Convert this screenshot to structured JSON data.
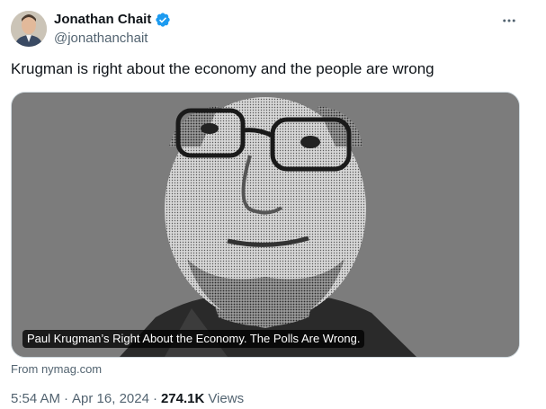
{
  "author": {
    "name": "Jonathan Chait",
    "handle": "@jonathanchait",
    "verified_color": "#1d9bf0"
  },
  "tweet": {
    "text": "Krugman is right about the economy and the people are wrong"
  },
  "card": {
    "caption": "Paul Krugman’s Right About the Economy. The Polls Are Wrong.",
    "source": "From nymag.com"
  },
  "meta": {
    "time": "5:54 AM",
    "date": "Apr 16, 2024",
    "views_count": "274.1K",
    "views_label": "Views"
  }
}
